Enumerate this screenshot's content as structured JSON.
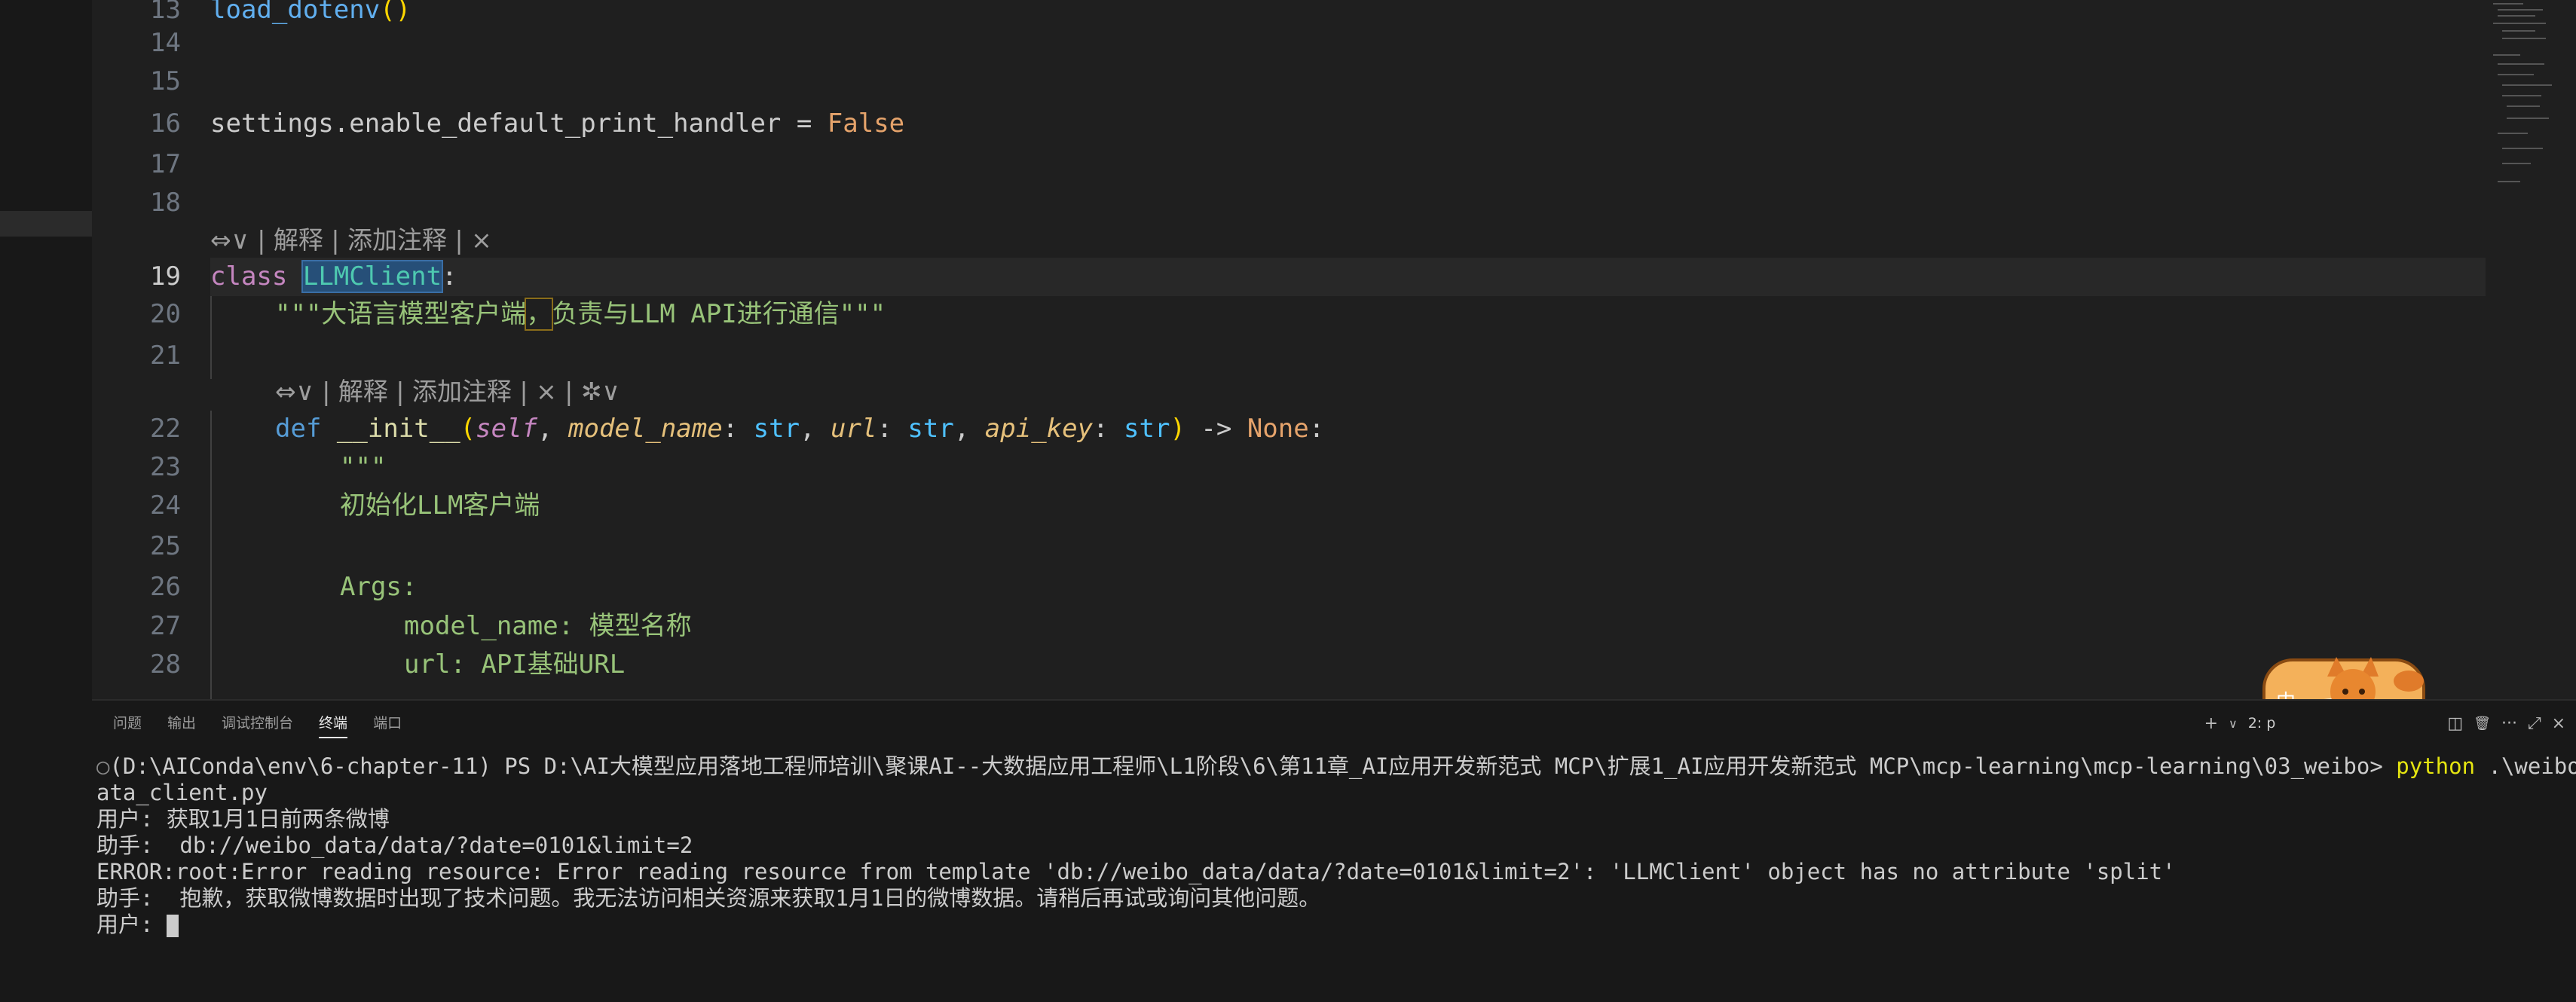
{
  "editor": {
    "lines": [
      {
        "num": "13",
        "text": "load_dotenv()"
      },
      {
        "num": "14",
        "text": ""
      },
      {
        "num": "15",
        "text": ""
      },
      {
        "num": "16",
        "text": "settings.enable_default_print_handler = False"
      },
      {
        "num": "17",
        "text": ""
      },
      {
        "num": "18",
        "text": ""
      },
      {
        "num": "19",
        "text": "class LLMClient:"
      },
      {
        "num": "20",
        "text": "\"\"\"大语言模型客户端，负责与LLM API进行通信\"\"\""
      },
      {
        "num": "21",
        "text": ""
      },
      {
        "num": "22",
        "text": "def __init__(self, model_name: str, url: str, api_key: str) -> None:"
      },
      {
        "num": "23",
        "text": "\"\"\""
      },
      {
        "num": "24",
        "text": "初始化LLM客户端"
      },
      {
        "num": "25",
        "text": ""
      },
      {
        "num": "26",
        "text": "Args:"
      },
      {
        "num": "27",
        "text": "model_name: 模型名称"
      },
      {
        "num": "28",
        "text": "url: API基础URL"
      }
    ],
    "tokens": {
      "load_dotenv": "load_dotenv",
      "paren_open": "(",
      "paren_close": ")",
      "settings_attr": "settings.enable_default_print_handler = ",
      "false_kw": "False",
      "class_kw": "class",
      "class_name": "LLMClient",
      "colon": ":",
      "doc_open": "\"\"\"大语言模型客户端",
      "doc_comma": "，",
      "doc_rest": "负责与LLM API进行通信\"\"\"",
      "def_kw": "def",
      "init_name": "__init__",
      "self_param": "self",
      "comma_sp": ", ",
      "model_name_param": "model_name",
      "url_param": "url",
      "api_key_param": "api_key",
      "colon_sp": ": ",
      "str_type": "str",
      "arrow": " -> ",
      "none_kw": "None",
      "triple_quote": "\"\"\"",
      "init_doc": "初始化LLM客户端",
      "args": "Args:",
      "model_name_doc": "model_name: 模型名称",
      "url_doc": "url: API基础URL"
    },
    "codelens_class": "⇔∨ | 解释 | 添加注释 | ×",
    "codelens_def": "⇔∨ | 解释 | 添加注释 | × | ✲∨"
  },
  "panel": {
    "tabs": [
      "问题",
      "输出",
      "调试控制台",
      "终端",
      "端口"
    ],
    "active_tab": "终端",
    "terminal_name": "2: p",
    "actions": {
      "add": "+",
      "add_chevron": "∨",
      "split": "◫",
      "trash": "🗑",
      "more": "···",
      "maximize": "⤢",
      "close": "×"
    }
  },
  "terminal": {
    "prompt_dot": "○",
    "prompt": "(D:\\AIConda\\env\\6-chapter-11) PS D:\\AI大模型应用落地工程师培训\\聚课AI--大数据应用工程师\\L1阶段\\6\\第11章_AI应用开发新范式 MCP\\扩展1_AI应用开发新范式 MCP\\mcp-learning\\mcp-learning\\03_weibo> ",
    "command": "python",
    "command_arg": " .\\weibo_d",
    "wrap": "ata_client.py",
    "lines": [
      "用户: 获取1月1日前两条微博",
      "助手:  db://weibo_data/data/?date=0101&limit=2",
      "ERROR:root:Error reading resource: Error reading resource from template 'db://weibo_data/data/?date=0101&limit=2': 'LLMClient' object has no attribute 'split'",
      "助手:  抱歉，获取微博数据时出现了技术问题。我无法访问相关资源来获取1月1日的微博数据。请稍后再试或询问其他问题。"
    ],
    "input_prompt": "用户: "
  },
  "mascot": {
    "label": "中",
    "icon": "fox-mascot-icon"
  }
}
